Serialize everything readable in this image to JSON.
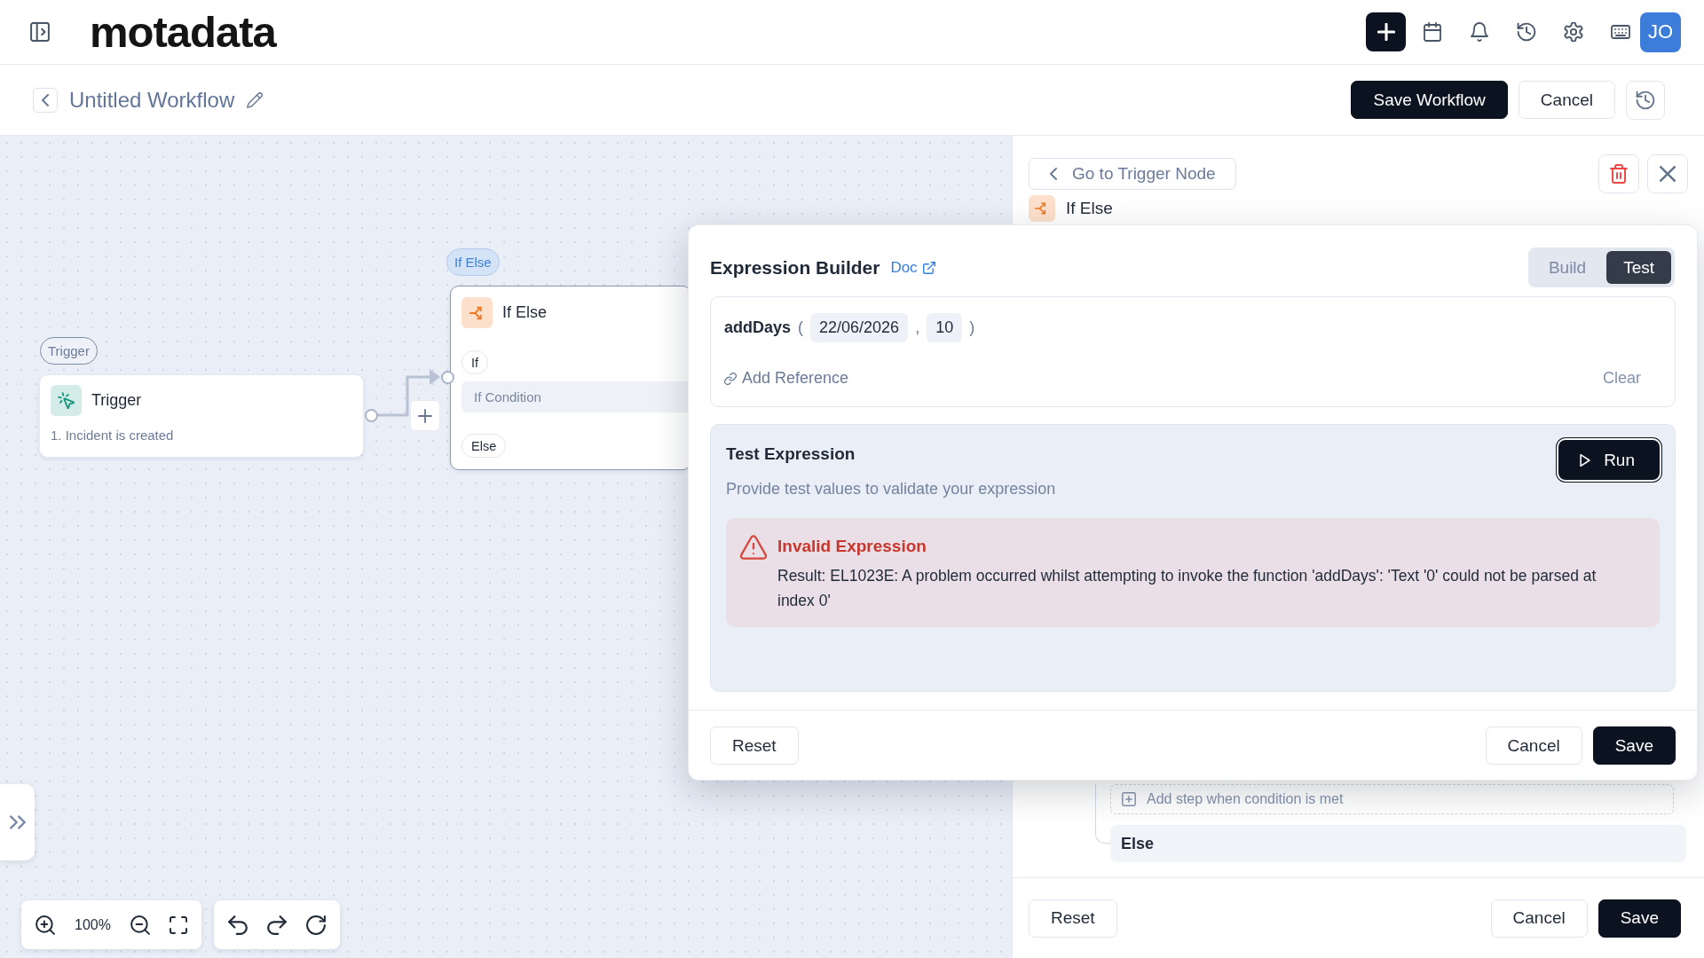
{
  "topbar": {
    "logo": "motadata",
    "avatar": "JO"
  },
  "header": {
    "title": "Untitled Workflow",
    "buttons": [
      {
        "label": "Save Workflow",
        "kind": "primary"
      },
      {
        "label": "Cancel",
        "kind": "secondary"
      }
    ]
  },
  "canvas": {
    "nodes": [
      {
        "kind": "trigger",
        "tag": "Trigger",
        "title": "Trigger",
        "selected": false,
        "detail": "1. Incident is created"
      },
      {
        "kind": "if_else",
        "tag": "If Else",
        "title": "If Else",
        "selected": true,
        "branches": [
          {
            "label": "If",
            "condition": "If Condition"
          },
          {
            "label": "Else"
          }
        ]
      }
    ],
    "zoom": "100%"
  },
  "panel": {
    "back_link": "Go to Trigger Node",
    "node": {
      "kind": "if_else",
      "title": "If Else"
    },
    "add_step": "Add step when condition is met",
    "else_branch": "Else",
    "footer": {
      "left": [
        {
          "label": "Reset",
          "kind": "secondary"
        }
      ],
      "right": [
        {
          "label": "Cancel",
          "kind": "secondary"
        },
        {
          "label": "Save",
          "kind": "primary"
        }
      ]
    }
  },
  "expression_builder": {
    "title": "Expression Builder",
    "doc_link": "Doc",
    "modes": [
      {
        "label": "Build",
        "selected": false
      },
      {
        "label": "Test",
        "selected": true
      }
    ],
    "tokens": [
      {
        "kind": "function",
        "text": "addDays"
      },
      {
        "kind": "punct",
        "text": "("
      },
      {
        "kind": "arg",
        "text": "22/06/2026"
      },
      {
        "kind": "punct",
        "text": ","
      },
      {
        "kind": "arg",
        "text": "10"
      },
      {
        "kind": "punct",
        "text": ")"
      }
    ],
    "add_reference": "Add Reference",
    "clear": "Clear",
    "test": {
      "title": "Test Expression",
      "subtitle": "Provide test values to validate your expression",
      "run": "Run",
      "error": {
        "title": "Invalid Expression",
        "message": "Result: EL1023E: A problem occurred whilst attempting to invoke the function 'addDays': 'Text '0' could not be parsed at index 0'"
      }
    },
    "footer": {
      "left": [
        {
          "label": "Reset",
          "kind": "secondary"
        }
      ],
      "right": [
        {
          "label": "Cancel",
          "kind": "secondary"
        },
        {
          "label": "Save",
          "kind": "primary"
        }
      ]
    }
  }
}
